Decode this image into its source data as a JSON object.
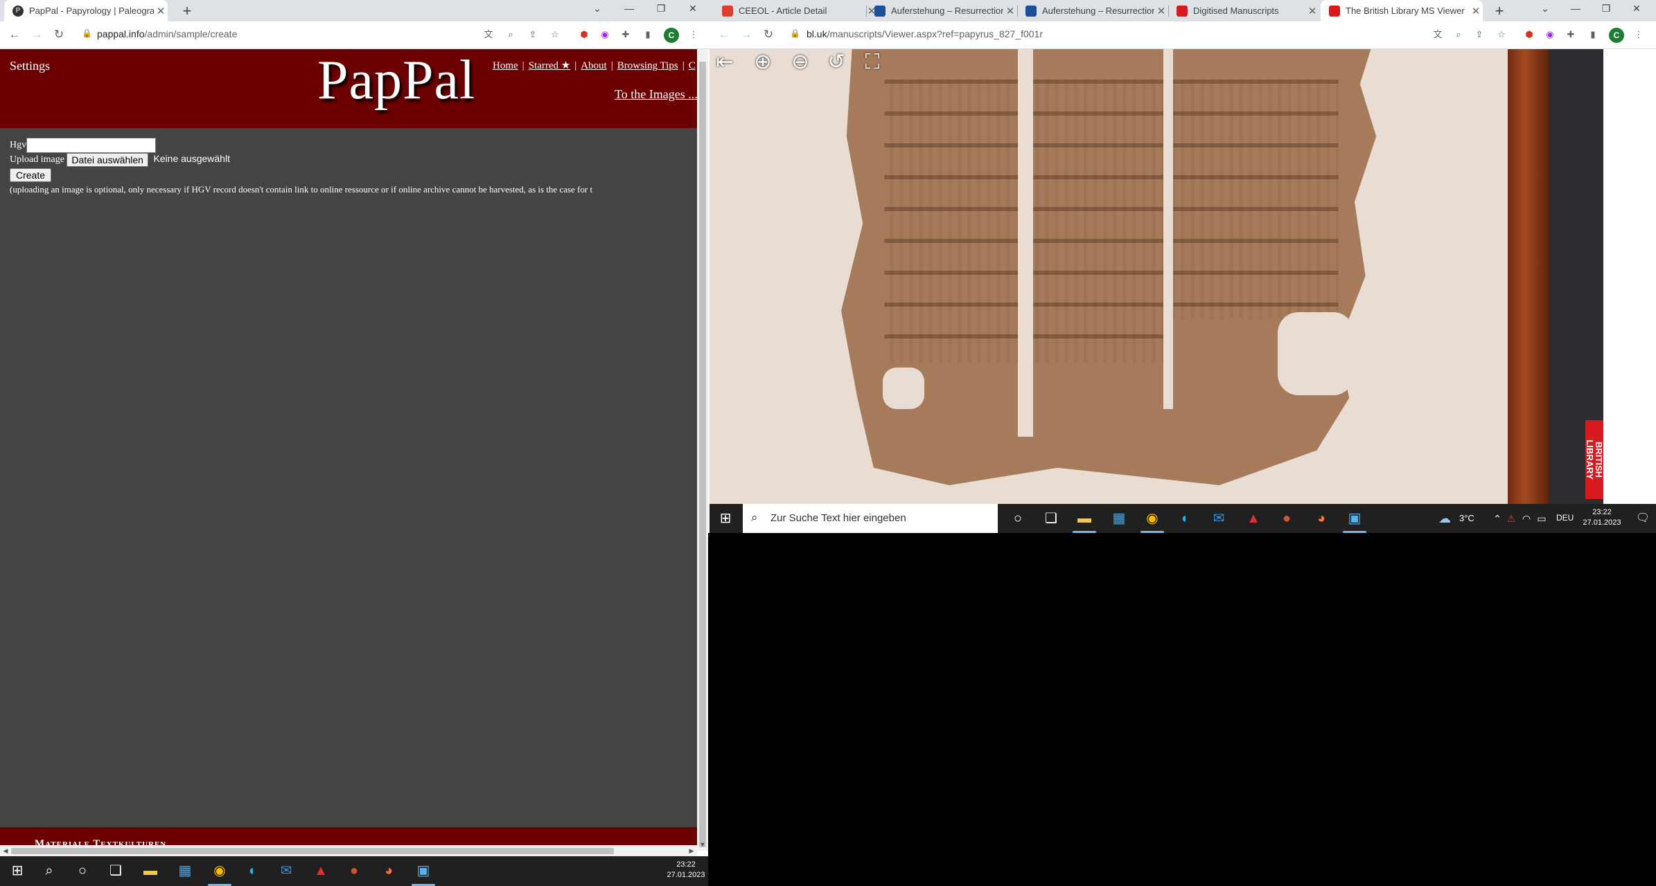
{
  "left_browser": {
    "tab_title": "PapPal - Papyrology | Paleograph",
    "url_host": "pappal.info",
    "url_path": "/admin/sample/create"
  },
  "pappal": {
    "settings_label": "Settings",
    "logo": "PapPal",
    "nav": [
      "Home",
      "Starred ★",
      "About",
      "Browsing Tips",
      "C"
    ],
    "to_images": "To the Images ...",
    "hgv_label": "Hgv",
    "upload_label": "Upload image",
    "file_button": "Datei auswählen",
    "no_file": "Keine ausgewählt",
    "create_button": "Create",
    "note": "(uploading an image is optional, only necessary if HGV record doesn't contain link to online ressource or if online archive cannot be harvested, as is the case for t",
    "footer": "Materiale Textkulturen"
  },
  "right_browser": {
    "tabs": [
      {
        "title": "CEEOL - Article Detail",
        "color": "#e03c31"
      },
      {
        "title": "Auferstehung – Resurrection",
        "color": "#1f4e9c"
      },
      {
        "title": "Auferstehung – Resurrection",
        "color": "#1f4e9c"
      },
      {
        "title": "Digitised Manuscripts",
        "color": "#d71920"
      },
      {
        "title": "The British Library MS Viewer",
        "color": "#d71920"
      }
    ],
    "url_host": "bl.uk",
    "url_path": "/manuscripts/Viewer.aspx?ref=papyrus_827_f001r"
  },
  "viewer": {
    "badge_text": "BRITISH LIBRARY"
  },
  "taskbar_right": {
    "search_placeholder": "Zur Suche Text hier eingeben",
    "weather": "3°C",
    "lang": "DEU",
    "time": "23:22",
    "date": "27.01.2023"
  },
  "taskbar_left": {
    "time": "23:22",
    "date": "27.01.2023"
  },
  "avatar_letter": "C"
}
